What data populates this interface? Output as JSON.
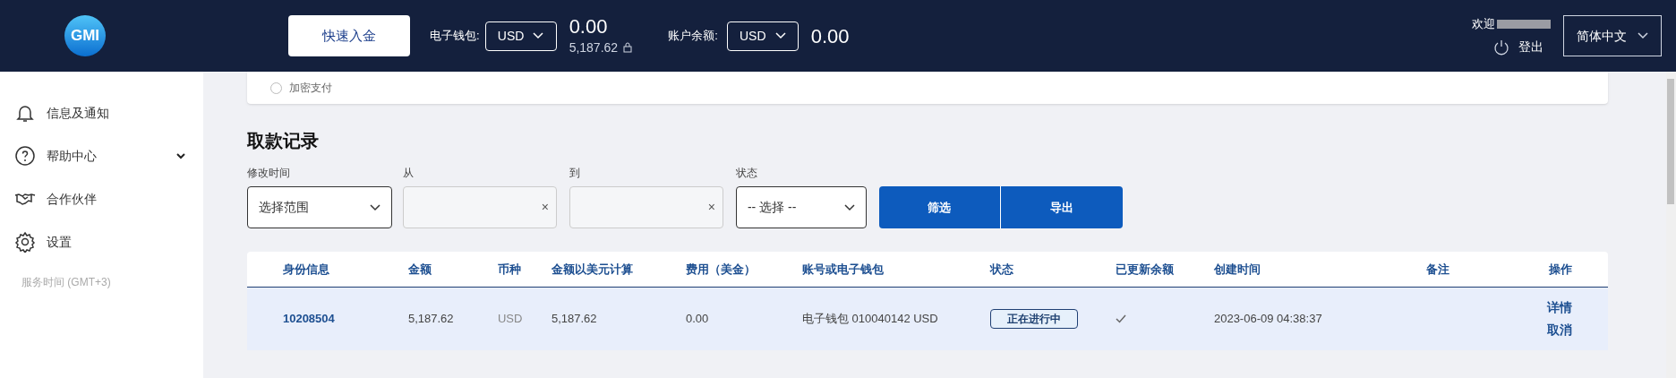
{
  "header": {
    "logo": "GMI",
    "deposit_button": "快速入金",
    "wallet": {
      "label": "电子钱包:",
      "currency": "USD",
      "amount": "0.00",
      "sub_amount": "5,187.62"
    },
    "balance": {
      "label": "账户余额:",
      "currency": "USD",
      "amount": "0.00"
    },
    "welcome": "欢迎",
    "logout": "登出",
    "language": "简体中文"
  },
  "sidebar": {
    "items": [
      {
        "label": "信息及通知",
        "kind": "bell",
        "expandable": false
      },
      {
        "label": "帮助中心",
        "kind": "help",
        "expandable": true
      },
      {
        "label": "合作伙伴",
        "kind": "handshake",
        "expandable": false
      },
      {
        "label": "设置",
        "kind": "gear",
        "expandable": false
      }
    ],
    "service_time": "服务时间 (GMT+3)"
  },
  "payment_option": {
    "label": "加密支付",
    "selected": false
  },
  "section_title": "取款记录",
  "filters": [
    {
      "kind": "select",
      "label": "修改时间",
      "value": "选择范围"
    },
    {
      "kind": "date",
      "label": "从",
      "clear": "×"
    },
    {
      "kind": "date",
      "label": "到",
      "clear": "×"
    },
    {
      "kind": "select",
      "label": "状态",
      "value": "-- 选择 --"
    }
  ],
  "buttons": [
    "筛选",
    "导出"
  ],
  "table": {
    "columns": [
      "身份信息",
      "金额",
      "币种",
      "金额以美元计算",
      "费用（美金）",
      "账号或电子钱包",
      "状态",
      "已更新余额",
      "创建时间",
      "备注",
      "操作"
    ],
    "rows": [
      {
        "id": "10208504",
        "amount": "5,187.62",
        "currency": "USD",
        "usd_amount": "5,187.62",
        "fee": "0.00",
        "account": "电子钱包 010040142 USD",
        "status": "正在进行中",
        "balance_updated": true,
        "created": "2023-06-09 04:38:37",
        "actions": [
          "详情",
          "取消"
        ]
      }
    ]
  }
}
